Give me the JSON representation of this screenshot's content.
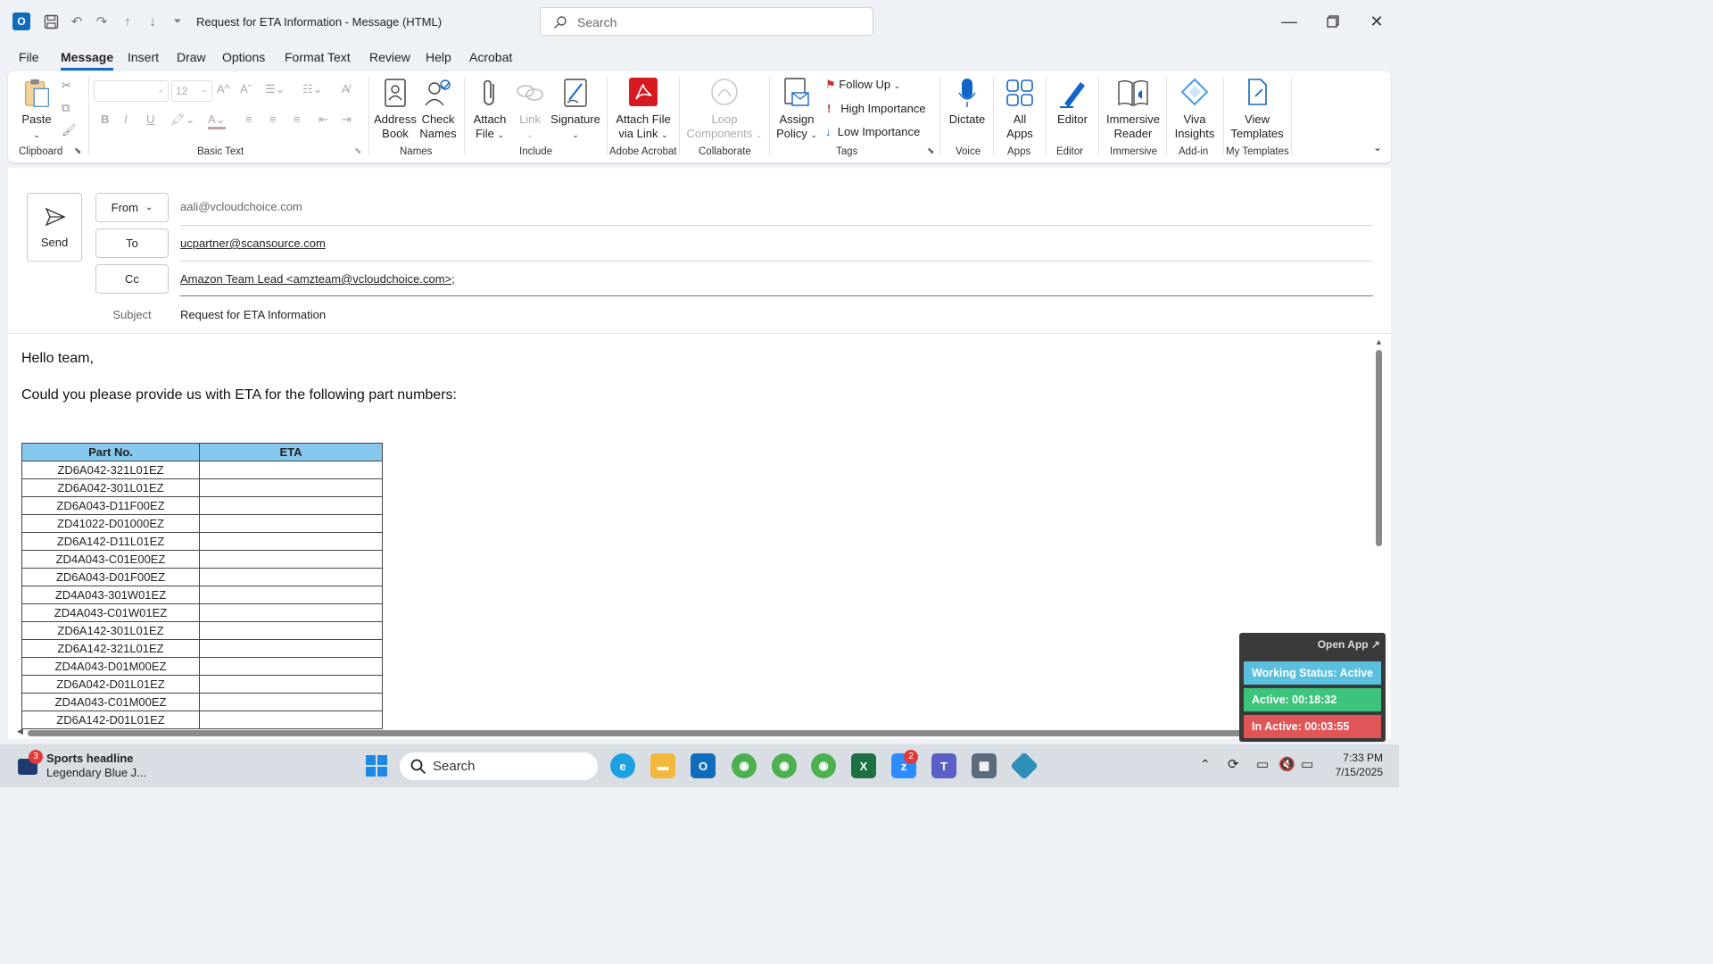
{
  "window": {
    "title": "Request for ETA Information  -  Message (HTML)",
    "search_placeholder": "Search"
  },
  "menu_tabs": [
    "File",
    "Message",
    "Insert",
    "Draw",
    "Options",
    "Format Text",
    "Review",
    "Help",
    "Acrobat"
  ],
  "ribbon": {
    "clipboard": {
      "paste": "Paste",
      "group": "Clipboard"
    },
    "basic_text": {
      "font_size": "12",
      "group": "Basic Text"
    },
    "names": {
      "address_book_1": "Address",
      "address_book_2": "Book",
      "check_names_1": "Check",
      "check_names_2": "Names",
      "group": "Names"
    },
    "include": {
      "attach_1": "Attach",
      "attach_2": "File",
      "link": "Link",
      "signature": "Signature",
      "group": "Include"
    },
    "acrobat": {
      "attach_link_1": "Attach File",
      "attach_link_2": "via Link",
      "group": "Adobe Acrobat"
    },
    "collaborate": {
      "loop_1": "Loop",
      "loop_2": "Components",
      "group": "Collaborate"
    },
    "tags": {
      "assign_1": "Assign",
      "assign_2": "Policy",
      "follow_up": "Follow Up",
      "high": "High Importance",
      "low": "Low Importance",
      "group": "Tags"
    },
    "voice": {
      "dictate": "Dictate",
      "group": "Voice"
    },
    "apps": {
      "all_1": "All",
      "all_2": "Apps",
      "group": "Apps"
    },
    "editor": {
      "editor": "Editor",
      "group": "Editor"
    },
    "immersive": {
      "reader_1": "Immersive",
      "reader_2": "Reader",
      "group": "Immersive"
    },
    "addin": {
      "viva_1": "Viva",
      "viva_2": "Insights",
      "group": "Add-in"
    },
    "templates": {
      "view_1": "View",
      "view_2": "Templates",
      "group": "My Templates"
    }
  },
  "compose": {
    "send": "Send",
    "from_label": "From",
    "from_value": "aali@vcloudchoice.com",
    "to_label": "To",
    "to_value": "ucpartner@scansource.com",
    "cc_label": "Cc",
    "cc_value": "Amazon Team Lead <amzteam@vcloudchoice.com>;",
    "subject_label": "Subject",
    "subject_value": "Request for ETA Information"
  },
  "body": {
    "greeting": "Hello team,",
    "request": "Could you please provide us with ETA for the following part numbers:",
    "table_headers": [
      "Part No.",
      "ETA"
    ],
    "parts": [
      "ZD6A042-321L01EZ",
      "ZD6A042-301L01EZ",
      "ZD6A043-D11F00EZ",
      "ZD41022-D01000EZ",
      "ZD6A142-D11L01EZ",
      "ZD4A043-C01E00EZ",
      "ZD6A043-D01F00EZ",
      "ZD4A043-301W01EZ",
      "ZD4A043-C01W01EZ",
      "ZD6A142-301L01EZ",
      "ZD6A142-321L01EZ",
      "ZD4A043-D01M00EZ",
      "ZD6A042-D01L01EZ",
      "ZD4A043-C01M00EZ",
      "ZD6A142-D01L01EZ"
    ]
  },
  "widget": {
    "open_app": "Open App ↗",
    "status": "Working Status: Active",
    "active": "Active: 00:18:32",
    "inactive": "In Active: 00:03:55",
    "colors": {
      "status": "#5bc0de",
      "active": "#3cc47c",
      "inactive": "#e05555"
    }
  },
  "taskbar": {
    "news_title": "Sports headline",
    "news_sub": "Legendary Blue J...",
    "news_badge": "3",
    "search": "Search",
    "zoom_badge": "2",
    "time": "7:33 PM",
    "date": "7/15/2025"
  }
}
